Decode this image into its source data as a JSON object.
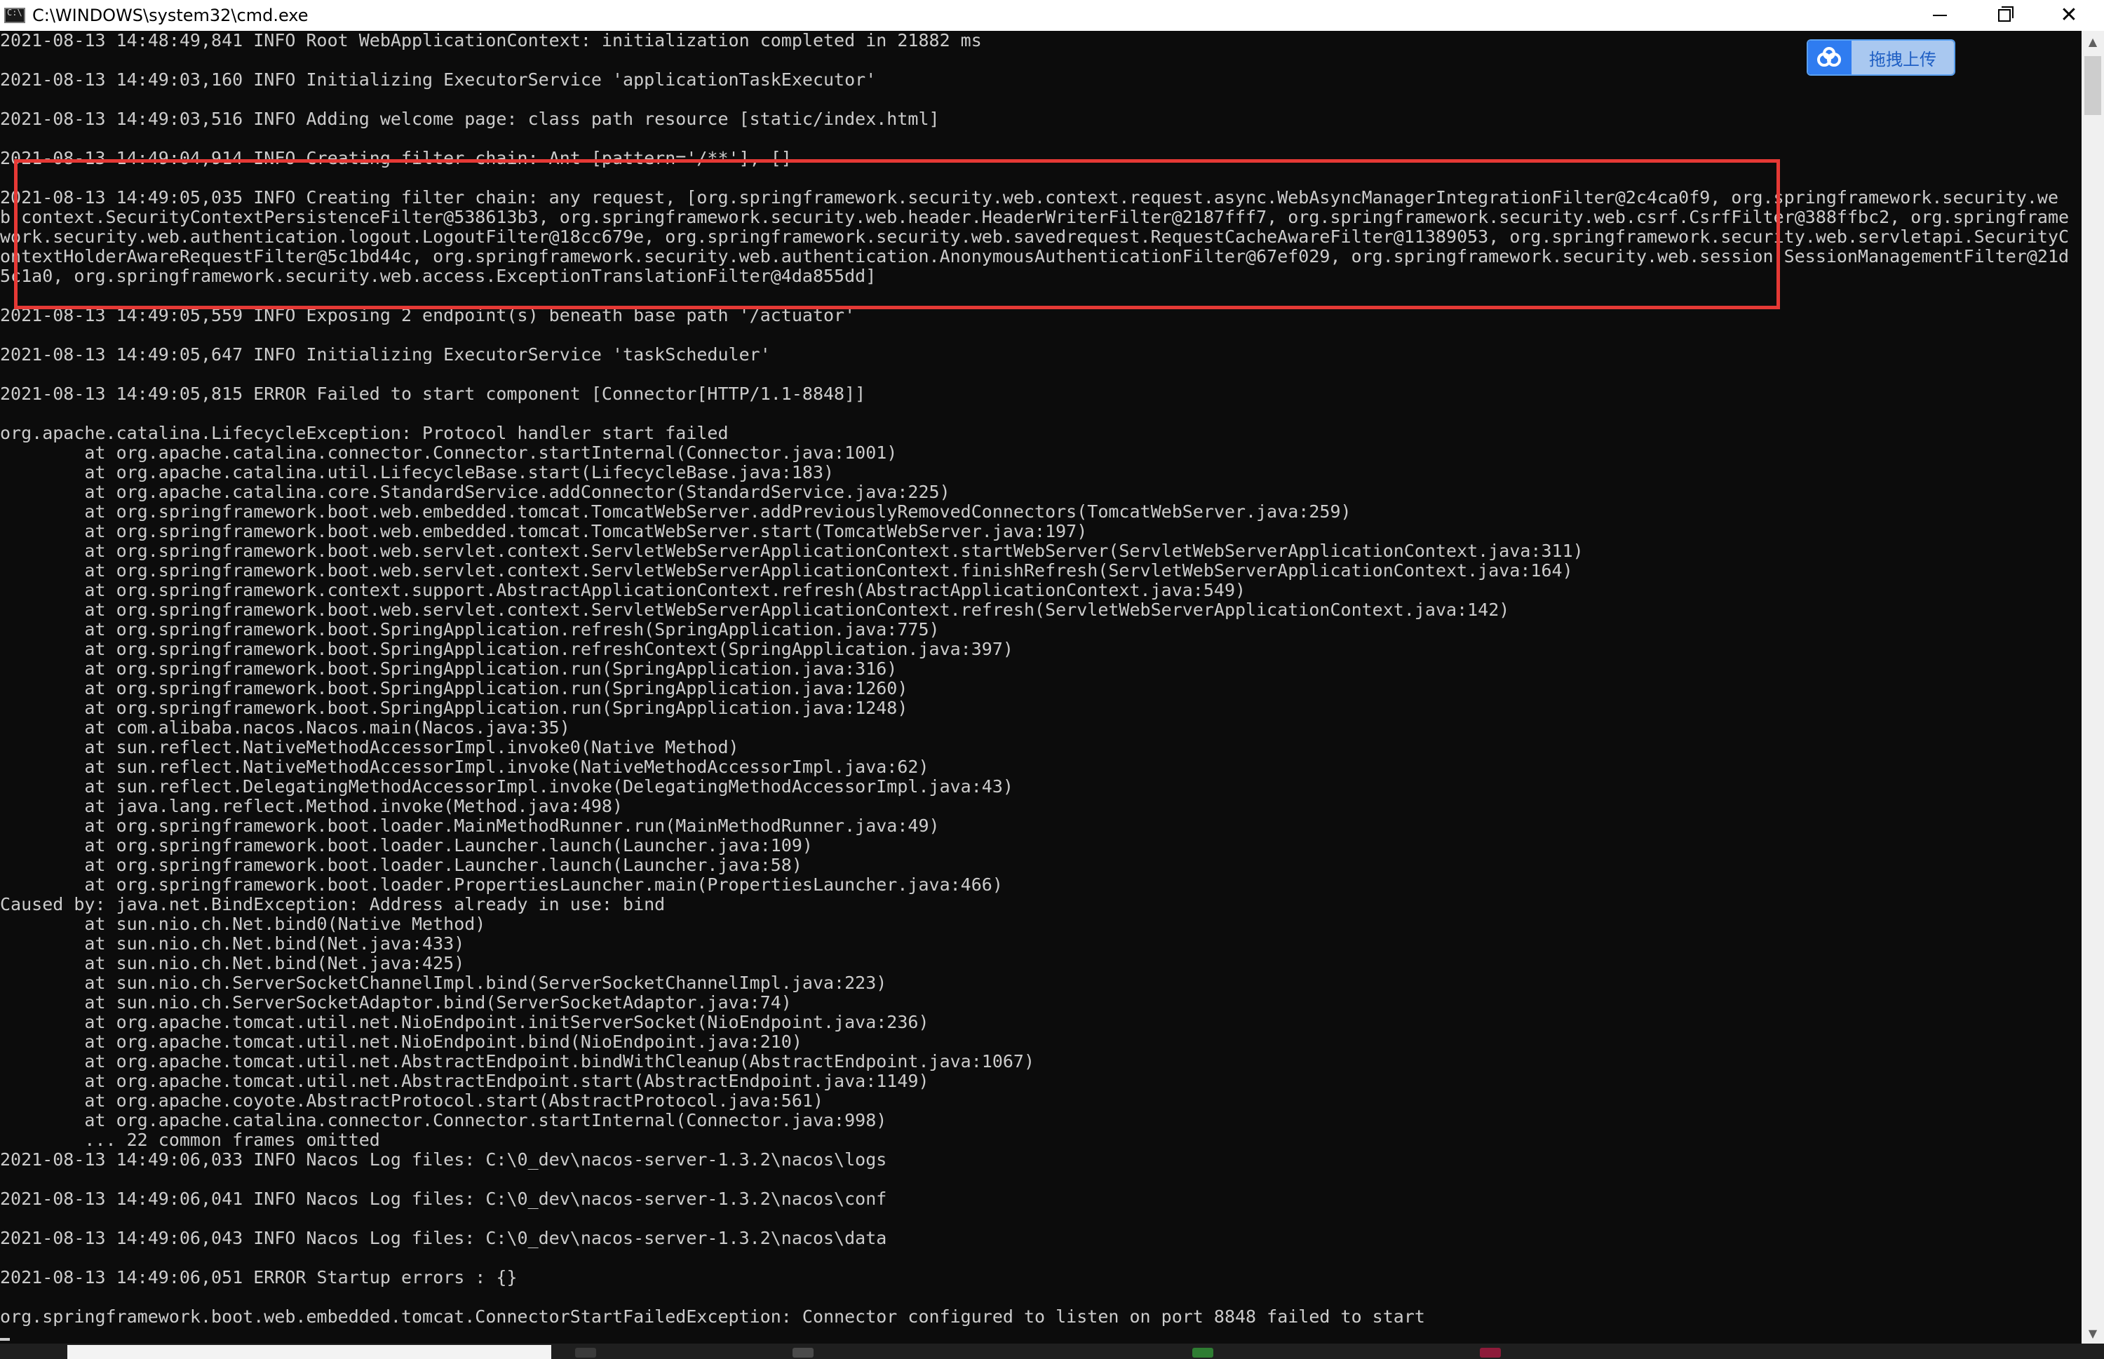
{
  "window": {
    "title": "C:\\WINDOWS\\system32\\cmd.exe"
  },
  "upload_widget": {
    "label": "拖拽上传"
  },
  "console": {
    "lines_before": [
      "2021-08-13 14:48:49,841 INFO Root WebApplicationContext: initialization completed in 21882 ms",
      "",
      "2021-08-13 14:49:03,160 INFO Initializing ExecutorService 'applicationTaskExecutor'",
      "",
      "2021-08-13 14:49:03,516 INFO Adding welcome page: class path resource [static/index.html]",
      "",
      "2021-08-13 14:49:04,914 INFO Creating filter chain: Ant [pattern='/**'], []",
      ""
    ],
    "filter_chain_line": "2021-08-13 14:49:05,035 INFO Creating filter chain: any request, [org.springframework.security.web.context.request.async.WebAsyncManagerIntegrationFilter@2c4ca0f9, org.springframework.security.web.context.SecurityContextPersistenceFilter@538613b3, org.springframework.security.web.header.HeaderWriterFilter@2187fff7, org.springframework.security.web.csrf.CsrfFilter@388ffbc2, org.springframework.security.web.authentication.logout.LogoutFilter@18cc679e, org.springframework.security.web.savedrequest.RequestCacheAwareFilter@11389053, org.springframework.security.web.servletapi.SecurityContextHolderAwareRequestFilter@5c1bd44c, org.springframework.security.web.authentication.AnonymousAuthenticationFilter@67ef029, org.springframework.security.web.session.SessionManagementFilter@21d5c1a0, org.springframework.security.web.access.ExceptionTranslationFilter@4da855dd]",
    "lines_after": [
      "",
      "2021-08-13 14:49:05,559 INFO Exposing 2 endpoint(s) beneath base path '/actuator'",
      "",
      "2021-08-13 14:49:05,647 INFO Initializing ExecutorService 'taskScheduler'",
      "",
      "2021-08-13 14:49:05,815 ERROR Failed to start component [Connector[HTTP/1.1-8848]]",
      "",
      "org.apache.catalina.LifecycleException: Protocol handler start failed",
      "        at org.apache.catalina.connector.Connector.startInternal(Connector.java:1001)",
      "        at org.apache.catalina.util.LifecycleBase.start(LifecycleBase.java:183)",
      "        at org.apache.catalina.core.StandardService.addConnector(StandardService.java:225)",
      "        at org.springframework.boot.web.embedded.tomcat.TomcatWebServer.addPreviouslyRemovedConnectors(TomcatWebServer.java:259)",
      "        at org.springframework.boot.web.embedded.tomcat.TomcatWebServer.start(TomcatWebServer.java:197)",
      "        at org.springframework.boot.web.servlet.context.ServletWebServerApplicationContext.startWebServer(ServletWebServerApplicationContext.java:311)",
      "        at org.springframework.boot.web.servlet.context.ServletWebServerApplicationContext.finishRefresh(ServletWebServerApplicationContext.java:164)",
      "        at org.springframework.context.support.AbstractApplicationContext.refresh(AbstractApplicationContext.java:549)",
      "        at org.springframework.boot.web.servlet.context.ServletWebServerApplicationContext.refresh(ServletWebServerApplicationContext.java:142)",
      "        at org.springframework.boot.SpringApplication.refresh(SpringApplication.java:775)",
      "        at org.springframework.boot.SpringApplication.refreshContext(SpringApplication.java:397)",
      "        at org.springframework.boot.SpringApplication.run(SpringApplication.java:316)",
      "        at org.springframework.boot.SpringApplication.run(SpringApplication.java:1260)",
      "        at org.springframework.boot.SpringApplication.run(SpringApplication.java:1248)",
      "        at com.alibaba.nacos.Nacos.main(Nacos.java:35)",
      "        at sun.reflect.NativeMethodAccessorImpl.invoke0(Native Method)",
      "        at sun.reflect.NativeMethodAccessorImpl.invoke(NativeMethodAccessorImpl.java:62)",
      "        at sun.reflect.DelegatingMethodAccessorImpl.invoke(DelegatingMethodAccessorImpl.java:43)",
      "        at java.lang.reflect.Method.invoke(Method.java:498)",
      "        at org.springframework.boot.loader.MainMethodRunner.run(MainMethodRunner.java:49)",
      "        at org.springframework.boot.loader.Launcher.launch(Launcher.java:109)",
      "        at org.springframework.boot.loader.Launcher.launch(Launcher.java:58)",
      "        at org.springframework.boot.loader.PropertiesLauncher.main(PropertiesLauncher.java:466)",
      "Caused by: java.net.BindException: Address already in use: bind",
      "        at sun.nio.ch.Net.bind0(Native Method)",
      "        at sun.nio.ch.Net.bind(Net.java:433)",
      "        at sun.nio.ch.Net.bind(Net.java:425)",
      "        at sun.nio.ch.ServerSocketChannelImpl.bind(ServerSocketChannelImpl.java:223)",
      "        at sun.nio.ch.ServerSocketAdaptor.bind(ServerSocketAdaptor.java:74)",
      "        at org.apache.tomcat.util.net.NioEndpoint.initServerSocket(NioEndpoint.java:236)",
      "        at org.apache.tomcat.util.net.NioEndpoint.bind(NioEndpoint.java:210)",
      "        at org.apache.tomcat.util.net.AbstractEndpoint.bindWithCleanup(AbstractEndpoint.java:1067)",
      "        at org.apache.tomcat.util.net.AbstractEndpoint.start(AbstractEndpoint.java:1149)",
      "        at org.apache.coyote.AbstractProtocol.start(AbstractProtocol.java:561)",
      "        at org.apache.catalina.connector.Connector.startInternal(Connector.java:998)",
      "        ... 22 common frames omitted",
      "2021-08-13 14:49:06,033 INFO Nacos Log files: C:\\0_dev\\nacos-server-1.3.2\\nacos\\logs",
      "",
      "2021-08-13 14:49:06,041 INFO Nacos Log files: C:\\0_dev\\nacos-server-1.3.2\\nacos\\conf",
      "",
      "2021-08-13 14:49:06,043 INFO Nacos Log files: C:\\0_dev\\nacos-server-1.3.2\\nacos\\data",
      "",
      "2021-08-13 14:49:06,051 ERROR Startup errors : {}",
      "",
      "org.springframework.boot.web.embedded.tomcat.ConnectorStartFailedException: Connector configured to listen on port 8848 failed to start"
    ]
  },
  "colors": {
    "console_bg": "#0c0c0c",
    "console_text": "#cccccc",
    "highlight_border": "#e53935",
    "upload_accent": "#2f7cf0"
  }
}
